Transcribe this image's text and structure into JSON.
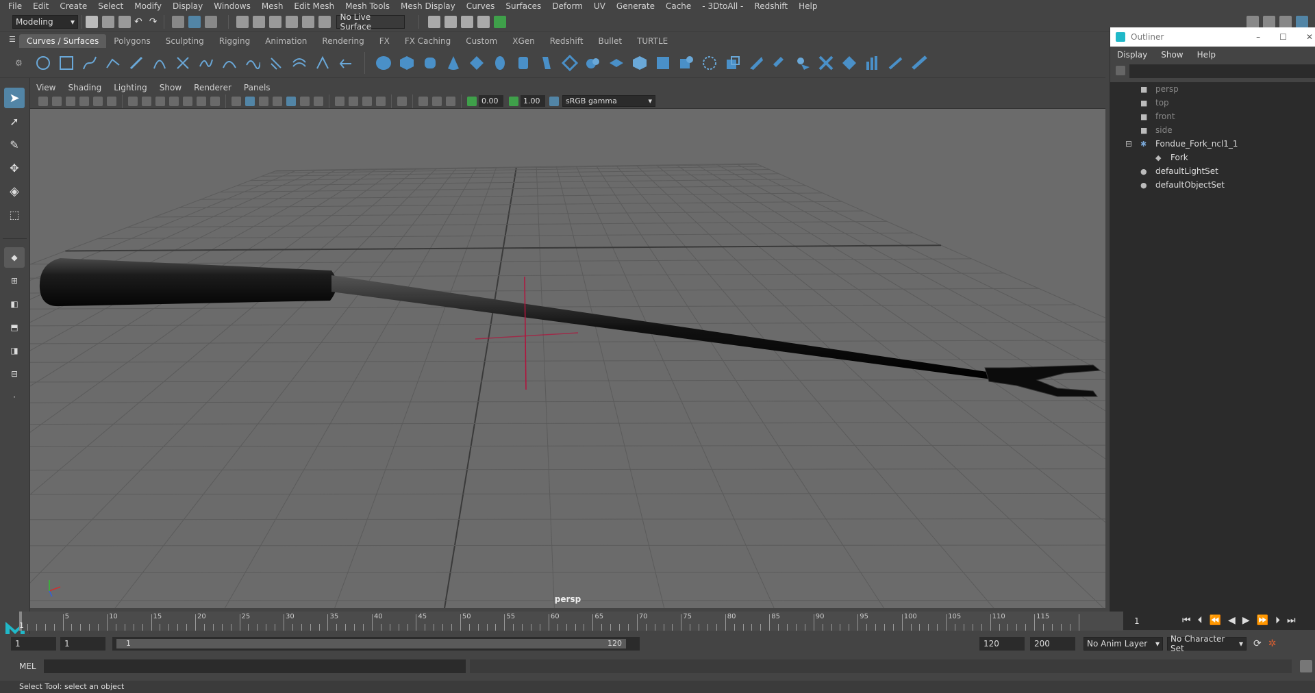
{
  "menu": [
    "File",
    "Edit",
    "Create",
    "Select",
    "Modify",
    "Display",
    "Windows",
    "Mesh",
    "Edit Mesh",
    "Mesh Tools",
    "Mesh Display",
    "Curves",
    "Surfaces",
    "Deform",
    "UV",
    "Generate",
    "Cache",
    "- 3DtoAll -",
    "Redshift",
    "Help"
  ],
  "status": {
    "mode": "Modeling",
    "live_surface": "No Live Surface"
  },
  "shelf_tabs": [
    "Curves / Surfaces",
    "Polygons",
    "Sculpting",
    "Rigging",
    "Animation",
    "Rendering",
    "FX",
    "FX Caching",
    "Custom",
    "XGen",
    "Redshift",
    "Bullet",
    "TURTLE"
  ],
  "panel_menu": [
    "View",
    "Shading",
    "Lighting",
    "Show",
    "Renderer",
    "Panels"
  ],
  "panel_toolbar": {
    "exposure": "0.00",
    "gamma": "1.00",
    "color_space": "sRGB gamma"
  },
  "viewport": {
    "camera_label": "persp",
    "grid_color": "#5a5a5a",
    "bg_color": "#6b6b6b"
  },
  "outliner": {
    "title": "Outliner",
    "menu": [
      "Display",
      "Show",
      "Help"
    ],
    "items": [
      {
        "label": "persp",
        "kind": "camera",
        "dim": true,
        "indent": 0
      },
      {
        "label": "top",
        "kind": "camera",
        "dim": true,
        "indent": 0
      },
      {
        "label": "front",
        "kind": "camera",
        "dim": true,
        "indent": 0
      },
      {
        "label": "side",
        "kind": "camera",
        "dim": true,
        "indent": 0
      },
      {
        "label": "Fondue_Fork_ncl1_1",
        "kind": "group",
        "dim": false,
        "indent": 0
      },
      {
        "label": "Fork",
        "kind": "mesh",
        "dim": false,
        "indent": 1
      },
      {
        "label": "defaultLightSet",
        "kind": "set",
        "dim": false,
        "indent": 0
      },
      {
        "label": "defaultObjectSet",
        "kind": "set",
        "dim": false,
        "indent": 0
      }
    ]
  },
  "timeline": {
    "ticks": [
      5,
      10,
      15,
      20,
      25,
      30,
      35,
      40,
      45,
      50,
      55,
      60,
      65,
      70,
      75,
      80,
      85,
      90,
      95,
      100,
      105,
      110,
      115
    ],
    "current_frame": "1",
    "start": 1,
    "end": 120
  },
  "range": {
    "start": "1",
    "anim_start": "1",
    "range_start": "1",
    "range_end": "120",
    "end": "120",
    "anim_end": "200",
    "anim_layer": "No Anim Layer",
    "character_set": "No Character Set"
  },
  "cmd": {
    "label": "MEL"
  },
  "help": {
    "text": "Select Tool: select an object"
  },
  "colors": {
    "accent": "#5285a6",
    "select_blue": "#4a78a0",
    "axis_red": "#b3123c"
  }
}
